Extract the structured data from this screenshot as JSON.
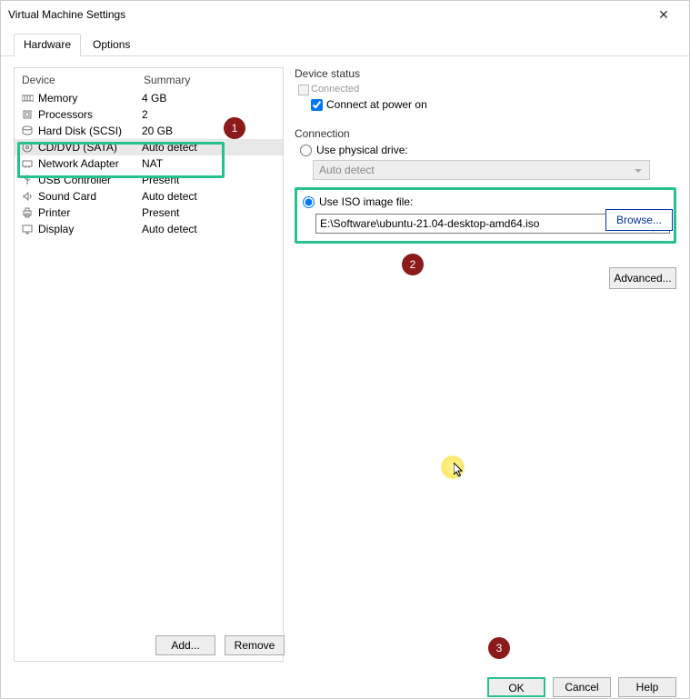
{
  "title": "Virtual Machine Settings",
  "tabs": {
    "hardware": "Hardware",
    "options": "Options"
  },
  "columns": {
    "device": "Device",
    "summary": "Summary"
  },
  "devices": [
    {
      "name": "Memory",
      "summary": "4 GB"
    },
    {
      "name": "Processors",
      "summary": "2"
    },
    {
      "name": "Hard Disk (SCSI)",
      "summary": "20 GB"
    },
    {
      "name": "CD/DVD (SATA)",
      "summary": "Auto detect"
    },
    {
      "name": "Network Adapter",
      "summary": "NAT"
    },
    {
      "name": "USB Controller",
      "summary": "Present"
    },
    {
      "name": "Sound Card",
      "summary": "Auto detect"
    },
    {
      "name": "Printer",
      "summary": "Present"
    },
    {
      "name": "Display",
      "summary": "Auto detect"
    }
  ],
  "status": {
    "title": "Device status",
    "connected": "Connected",
    "power_on": "Connect at power on"
  },
  "connection": {
    "title": "Connection",
    "physical": "Use physical drive:",
    "physical_value": "Auto detect",
    "iso": "Use ISO image file:",
    "iso_value": "E:\\Software\\ubuntu-21.04-desktop-amd64.iso",
    "browse": "Browse...",
    "advanced": "Advanced..."
  },
  "buttons": {
    "add": "Add...",
    "remove": "Remove",
    "ok": "OK",
    "cancel": "Cancel",
    "help": "Help"
  },
  "callouts": {
    "c1": "1",
    "c2": "2",
    "c3": "3"
  }
}
